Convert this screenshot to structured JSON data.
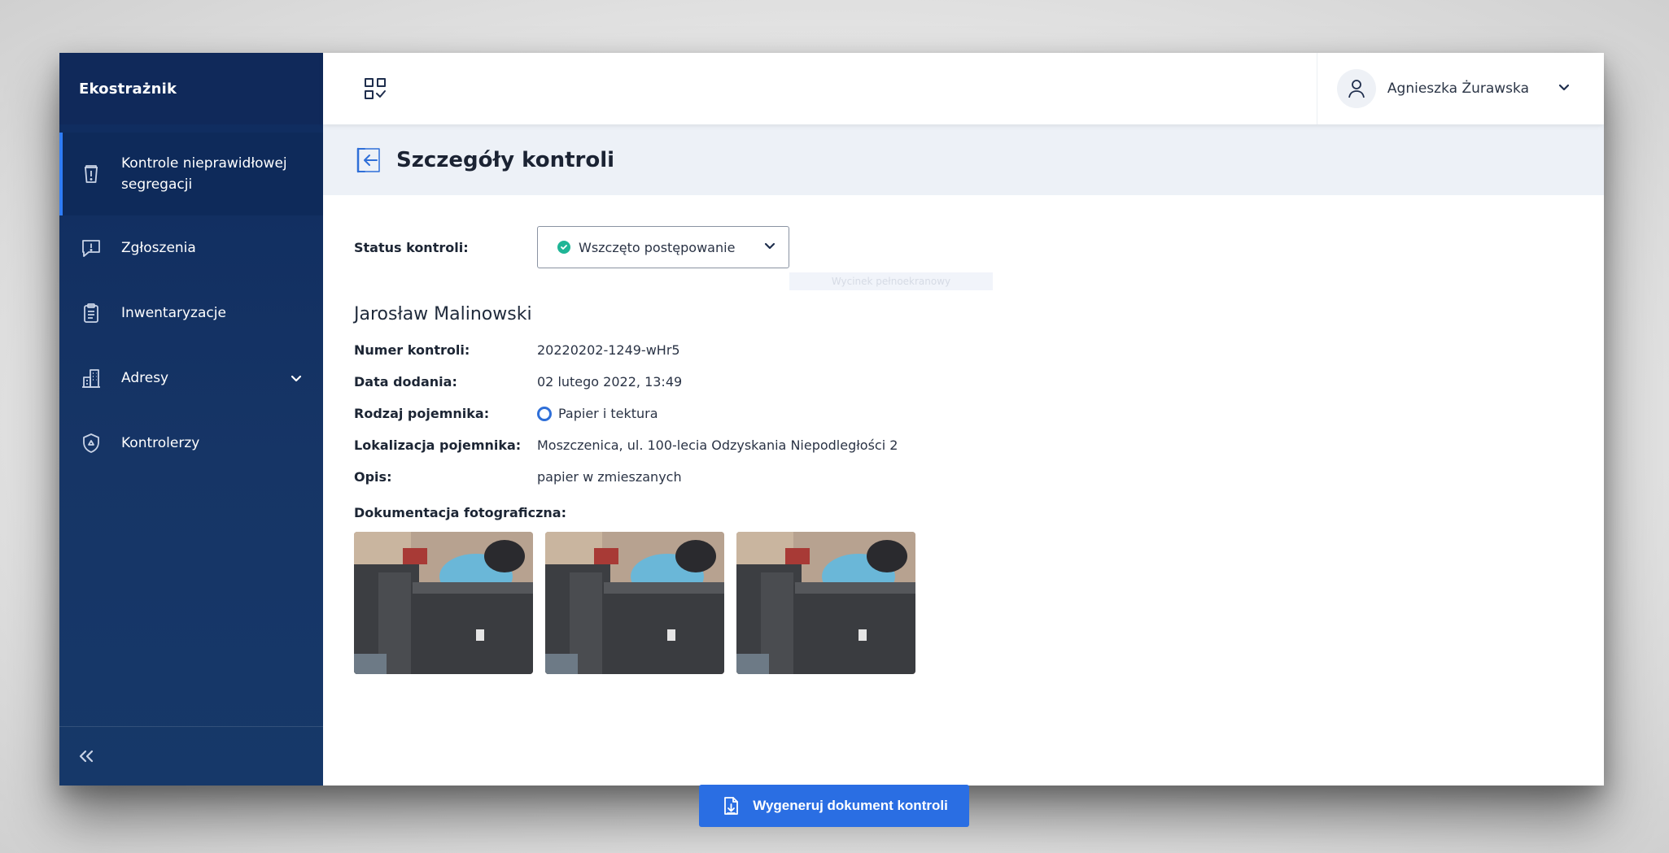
{
  "app": {
    "brand": "Ekostrażnik"
  },
  "sidebar": {
    "items": [
      {
        "label": "Kontrole nieprawidłowej segregacji",
        "icon": "bin-alert-icon",
        "active": true
      },
      {
        "label": "Zgłoszenia",
        "icon": "message-alert-icon"
      },
      {
        "label": "Inwentaryzacje",
        "icon": "clipboard-icon"
      },
      {
        "label": "Adresy",
        "icon": "buildings-icon",
        "expandable": true
      },
      {
        "label": "Kontrolerzy",
        "icon": "shield-recycle-icon"
      }
    ],
    "collapse_icon": "double-chevron-left-icon"
  },
  "topbar": {
    "apps_icon": "grid-check-icon",
    "user_name": "Agnieszka Żurawska"
  },
  "page": {
    "title": "Szczegóły kontroli"
  },
  "details": {
    "status_label": "Status kontroli:",
    "status_value": "Wszczęto postępowanie",
    "ghost_text": "Wycinek pełnoekranowy",
    "person": "Jarosław Malinowski",
    "fields": [
      {
        "label": "Numer kontroli:",
        "value": "20220202-1249-wHr5"
      },
      {
        "label": "Data dodania:",
        "value": "02 lutego 2022, 13:49"
      },
      {
        "label": "Rodzaj pojemnika:",
        "value": "Papier i tektura"
      },
      {
        "label": "Lokalizacja pojemnika:",
        "value": "Moszczenica, ul. 100-lecia Odzyskania Niepodległości 2"
      },
      {
        "label": "Opis:",
        "value": "papier w zmieszanych"
      }
    ],
    "photos_label": "Dokumentacja fotograficzna:",
    "photos_count": 3
  },
  "actions": {
    "generate_label": "Wygeneruj dokument kontroli"
  },
  "colors": {
    "sidebar": "#163566",
    "accent": "#2a6ee3",
    "status_ok": "#1fb596",
    "header_bg": "#edf1f7"
  }
}
